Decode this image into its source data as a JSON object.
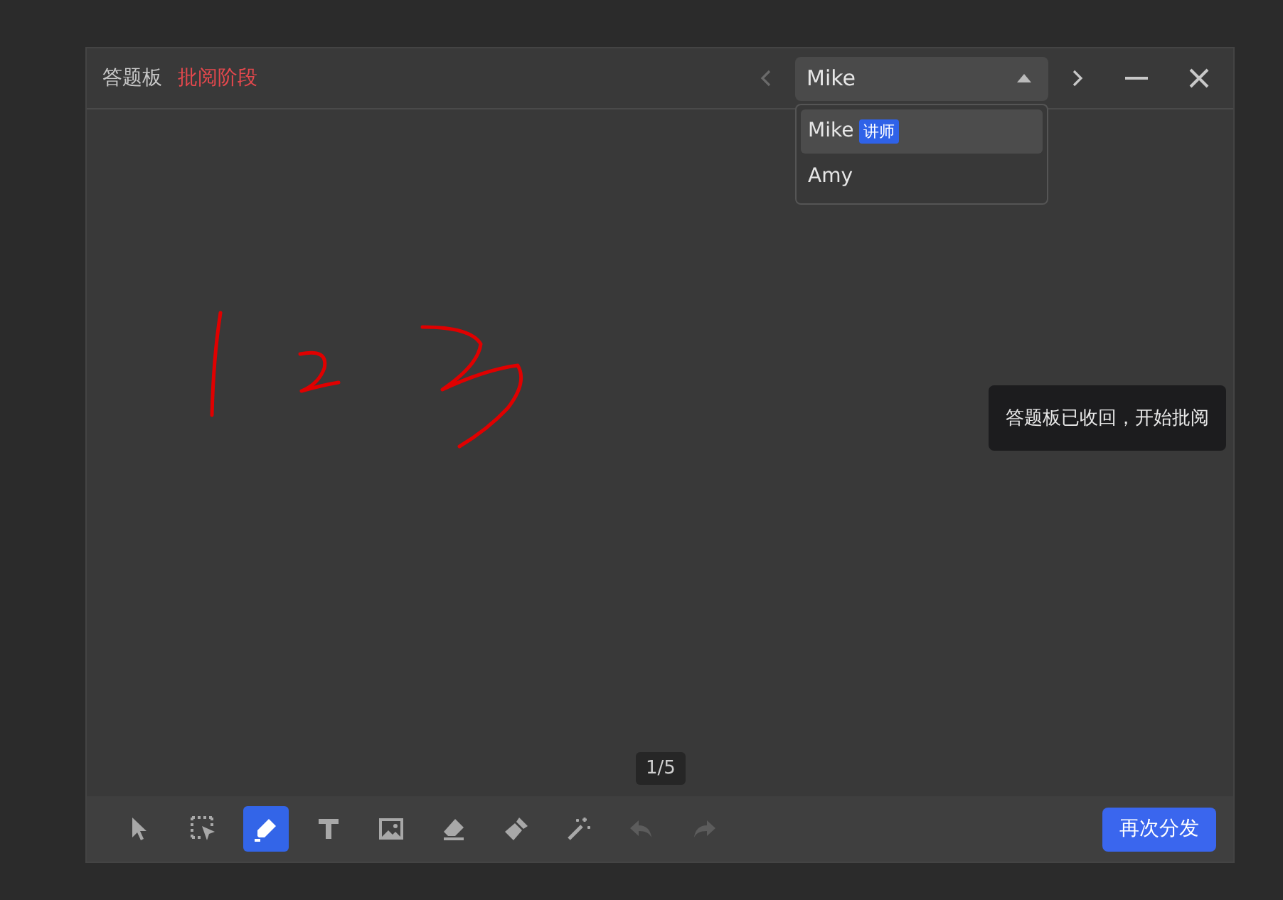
{
  "window": {
    "title": "答题板",
    "stage": "批阅阶段"
  },
  "student_select": {
    "value": "Mike",
    "expanded": true,
    "prev_disabled": true,
    "next_disabled": false,
    "options": [
      {
        "label": "Mike",
        "badge": "讲师",
        "selected": true
      },
      {
        "label": "Amy",
        "selected": false
      }
    ]
  },
  "toast": "答题板已收回，开始批阅",
  "page_counter": "1/5",
  "tools": [
    {
      "kind": "pointer",
      "selected": false,
      "disabled": false
    },
    {
      "kind": "box-select",
      "selected": false,
      "disabled": false
    },
    {
      "kind": "pen",
      "selected": true,
      "disabled": false
    },
    {
      "kind": "text",
      "selected": false,
      "disabled": false
    },
    {
      "kind": "image",
      "selected": false,
      "disabled": false
    },
    {
      "kind": "eraser",
      "selected": false,
      "disabled": false
    },
    {
      "kind": "brush",
      "selected": false,
      "disabled": false
    },
    {
      "kind": "wand",
      "selected": false,
      "disabled": false
    },
    {
      "kind": "undo",
      "selected": false,
      "disabled": true
    },
    {
      "kind": "redo",
      "selected": false,
      "disabled": true
    }
  ],
  "action_button": "再次分发"
}
